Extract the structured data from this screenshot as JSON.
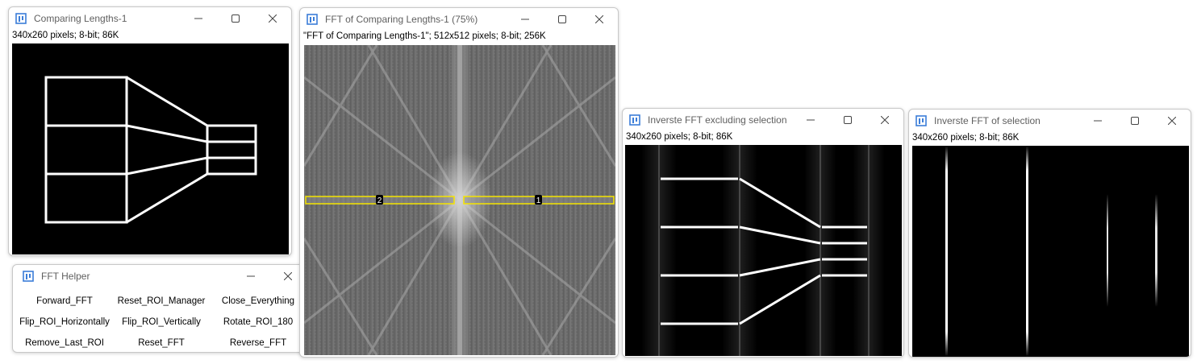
{
  "windows": {
    "comparing": {
      "title": "Comparing Lengths-1",
      "info": "340x260 pixels; 8-bit; 86K"
    },
    "fft": {
      "title": "FFT of Comparing Lengths-1 (75%)",
      "info": "\"FFT of Comparing Lengths-1\"; 512x512 pixels; 8-bit; 256K",
      "roi_labels": [
        "2",
        "1"
      ]
    },
    "inverse_excl": {
      "title": "Inverste FFT excluding selection",
      "info": "340x260 pixels; 8-bit; 86K"
    },
    "inverse_sel": {
      "title": "Inverste FFT of selection",
      "info": "340x260 pixels; 8-bit; 86K"
    },
    "helper": {
      "title": "FFT Helper",
      "buttons": [
        "Forward_FFT",
        "Reset_ROI_Manager",
        "Close_Everything",
        "Flip_ROI_Horizontally",
        "Flip_ROI_Vertically",
        "Rotate_ROI_180",
        "Remove_Last_ROI",
        "Reset_FFT",
        "Reverse_FFT"
      ]
    }
  },
  "icons": {
    "app": "imagej-icon",
    "minimize": "minimize-icon",
    "maximize": "maximize-icon",
    "close": "close-icon"
  },
  "colors": {
    "roi": "#f5e400",
    "image_bg": "#000000",
    "line": "#ffffff",
    "app_icon": "#3b7dd8"
  }
}
